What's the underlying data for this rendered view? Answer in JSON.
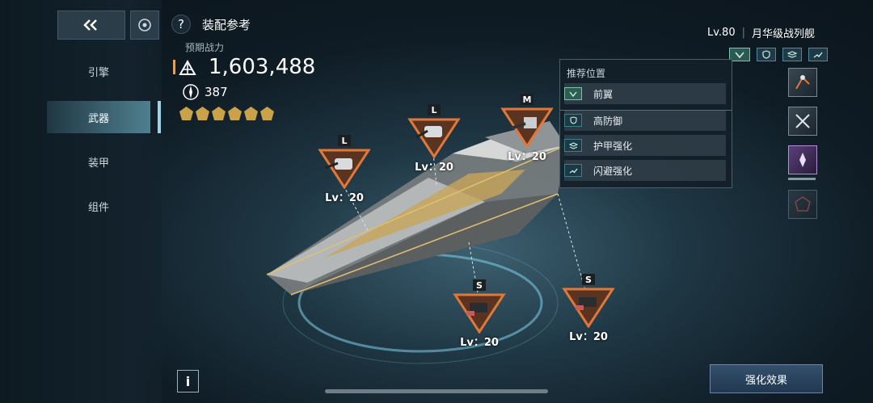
{
  "header": {
    "title": "装配参考",
    "power_label": "预期战力",
    "power_value": "1,603,488",
    "sub_value": "387",
    "stars": 6
  },
  "nav": {
    "back_icon": "double-chevron-left-icon",
    "home_icon": "target-icon",
    "items": [
      {
        "label": "引擎",
        "active": false
      },
      {
        "label": "武器",
        "active": true
      },
      {
        "label": "装甲",
        "active": false
      },
      {
        "label": "组件",
        "active": false
      }
    ]
  },
  "ship": {
    "level": "Lv.80",
    "name": "月华级战列舰"
  },
  "popup": {
    "heading": "推荐位置",
    "rows": [
      {
        "label": "前翼",
        "icon": "chevron-down-icon"
      },
      {
        "label": "高防御",
        "icon": "shield-icon"
      },
      {
        "label": "护甲强化",
        "icon": "layers-icon"
      },
      {
        "label": "闪避强化",
        "icon": "dodge-icon"
      }
    ]
  },
  "weapons": [
    {
      "size": "L",
      "level": "Lv：20"
    },
    {
      "size": "L",
      "level": "Lv：20"
    },
    {
      "size": "M",
      "level": "Lv：20"
    },
    {
      "size": "S",
      "level": "Lv：20"
    },
    {
      "size": "S",
      "level": "Lv：20"
    }
  ],
  "buttons": {
    "info": "i",
    "enhance": "强化效果",
    "help": "?"
  },
  "colors": {
    "accent": "#e0783a",
    "panel": "#142028",
    "highlight": "#9fd3e6"
  }
}
